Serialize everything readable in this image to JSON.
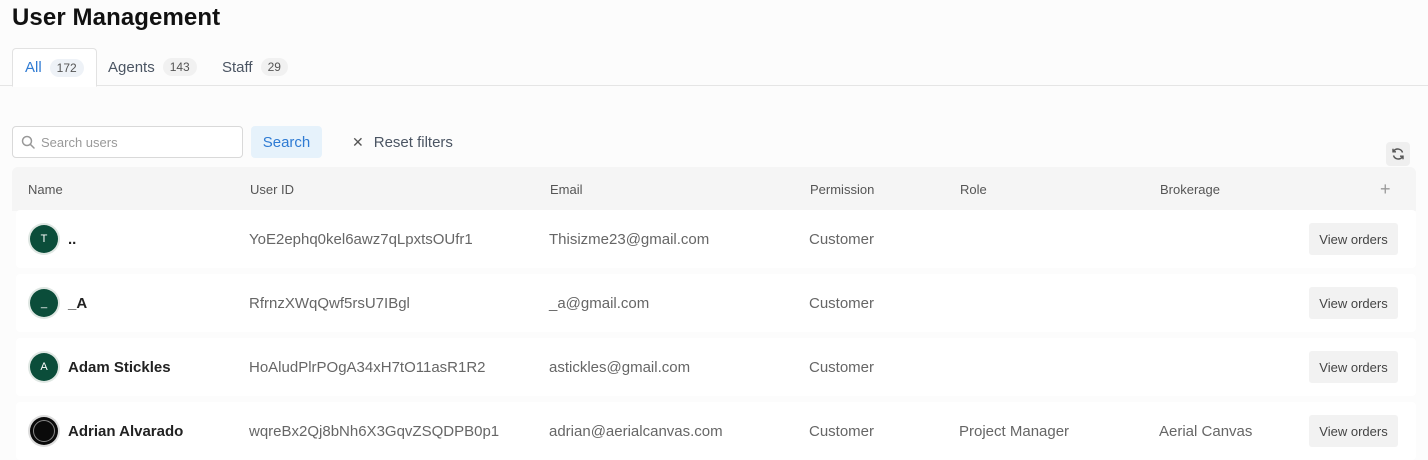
{
  "page": {
    "title": "User Management"
  },
  "tabs": [
    {
      "label": "All",
      "count": "172",
      "active": true
    },
    {
      "label": "Agents",
      "count": "143",
      "active": false
    },
    {
      "label": "Staff",
      "count": "29",
      "active": false
    }
  ],
  "filters": {
    "search_placeholder": "Search users",
    "search_value": "",
    "search_button": "Search",
    "reset_label": "Reset filters",
    "reset_icon": "close-icon",
    "search_icon": "search-icon",
    "refresh_icon": "refresh-icon"
  },
  "table": {
    "columns": [
      "Name",
      "User ID",
      "Email",
      "Permission",
      "Role",
      "Brokerage"
    ],
    "add_column_icon": "plus-icon",
    "rows": [
      {
        "initial": "T",
        "name": "..",
        "user_id": "YoE2ephq0kel6awz7qLpxtsOUfr1",
        "email": "Thisizme23@gmail.com",
        "permission": "Customer",
        "role": "",
        "brokerage": "",
        "action": "View orders",
        "avatar_type": "initial"
      },
      {
        "initial": "_",
        "name": "_A",
        "user_id": "RfrnzXWqQwf5rsU7IBgl",
        "email": "_a@gmail.com",
        "permission": "Customer",
        "role": "",
        "brokerage": "",
        "action": "View orders",
        "avatar_type": "initial"
      },
      {
        "initial": "A",
        "name": "Adam Stickles",
        "user_id": "HoAludPlrPOgA34xH7tO11asR1R2",
        "email": "astickles@gmail.com",
        "permission": "Customer",
        "role": "",
        "brokerage": "",
        "action": "View orders",
        "avatar_type": "initial"
      },
      {
        "initial": "",
        "name": "Adrian Alvarado",
        "user_id": "wqreBx2Qj8bNh6X3GqvZSQDPB0p1",
        "email": "adrian@aerialcanvas.com",
        "permission": "Customer",
        "role": "Project Manager",
        "brokerage": "Aerial Canvas",
        "action": "View orders",
        "avatar_type": "image"
      }
    ]
  },
  "colors": {
    "accent": "#2f7bd3",
    "avatar_bg": "#0b4d3a",
    "search_btn_bg": "#e6f2fb"
  }
}
